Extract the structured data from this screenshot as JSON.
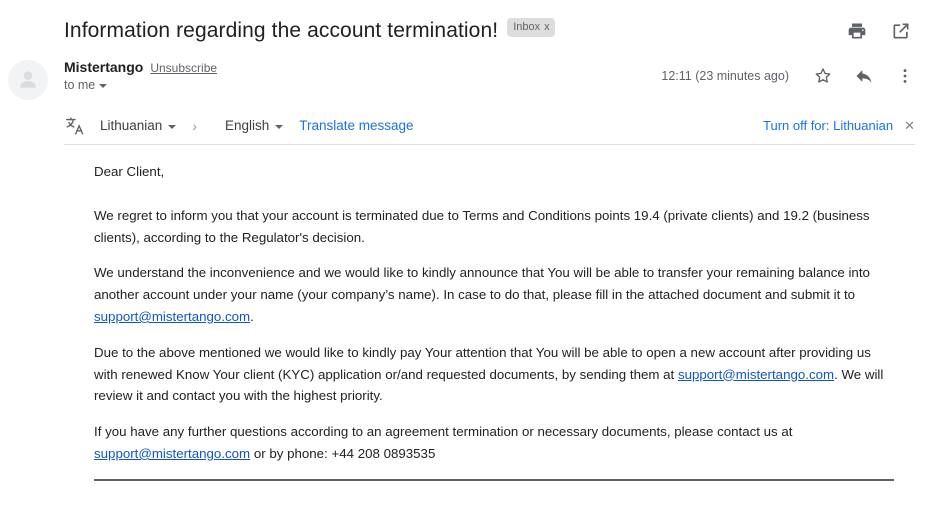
{
  "header": {
    "subject": "Information regarding the account termination!",
    "label_badge": "Inbox",
    "label_badge_close": "x",
    "print_icon": "print-icon",
    "popout_icon": "open-in-new-window-icon"
  },
  "sender": {
    "avatar_icon": "person-avatar-icon",
    "name": "Mistertango",
    "unsubscribe": "Unsubscribe",
    "recipient": "to me",
    "recipient_caret": "chevron-down-icon",
    "timestamp": "12:11 (23 minutes ago)",
    "star_icon": "star-icon",
    "reply_icon": "reply-icon",
    "more_icon": "more-options-icon"
  },
  "translate": {
    "icon": "translate-icon",
    "source_language": "Lithuanian",
    "separator": "›",
    "target_language": "English",
    "action_link": "Translate message",
    "turn_off_label": "Turn off for: Lithuanian",
    "close": "✕"
  },
  "message": {
    "greeting": "Dear Client,",
    "paragraph_1": "We regret to inform you that your account is terminated due to Terms and Conditions points 19.4 (private clients) and 19.2 (business clients), according to the Regulator's decision.",
    "paragraph_2_part1": "We understand the inconvenience and we would like to kindly announce that You will be able to transfer your remaining balance into another account under your name (your company’s name). In case to do that, please fill in the attached document and submit it to ",
    "paragraph_2_link": "support@mistertango.com",
    "paragraph_2_part2": ".",
    "paragraph_3_part1": "Due to the above mentioned we would like to kindly pay Your attention that You will be able to open a new account after providing us with renewed Know Your client (KYC) application or/and requested documents, by sending them at ",
    "paragraph_3_link": "support@mistertango.com",
    "paragraph_3_part2": ". We will review it and contact you with the highest priority.",
    "paragraph_4_part1": "If you have any further questions according to an agreement termination or necessary documents, please contact us at ",
    "paragraph_4_link": "support@mistertango.com",
    "paragraph_4_part2": " or by phone: +44 208 0893535"
  },
  "colors": {
    "accent_blue": "#1a73e8",
    "link_blue": "#1155cc",
    "text_primary": "#202124",
    "text_secondary": "#5f6368",
    "badge_bg": "#dddddd"
  }
}
